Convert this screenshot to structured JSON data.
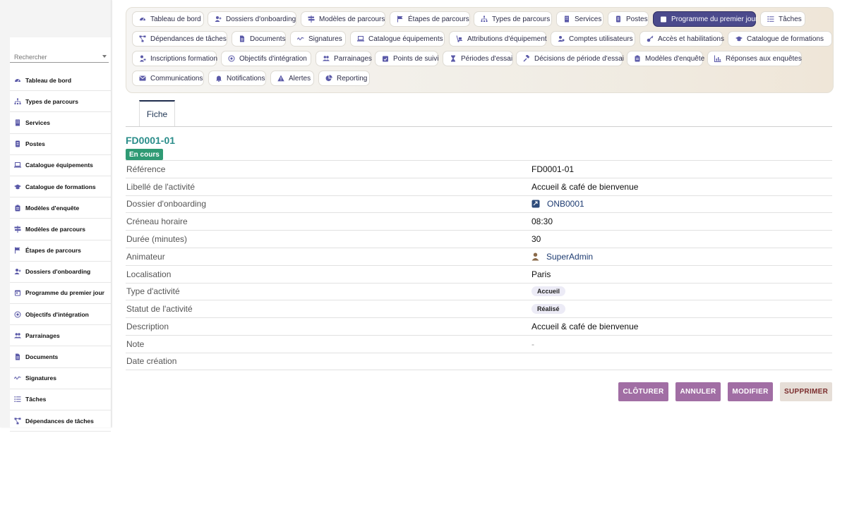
{
  "search": {
    "placeholder": "Rechercher"
  },
  "sidebar": {
    "items": [
      {
        "label": "Tableau de bord",
        "icon": "dashboard-icon"
      },
      {
        "label": "Types de parcours",
        "icon": "sitemap-icon"
      },
      {
        "label": "Services",
        "icon": "building-icon"
      },
      {
        "label": "Postes",
        "icon": "id-badge-icon"
      },
      {
        "label": "Catalogue équipements",
        "icon": "laptop-icon"
      },
      {
        "label": "Catalogue de formations",
        "icon": "graduation-cap-icon"
      },
      {
        "label": "Modèles d'enquête",
        "icon": "clipboard-icon"
      },
      {
        "label": "Modèles de parcours",
        "icon": "signpost-icon"
      },
      {
        "label": "Étapes de parcours",
        "icon": "flag-icon"
      },
      {
        "label": "Dossiers d'onboarding",
        "icon": "user-plus-icon"
      },
      {
        "label": "Programme du premier jour",
        "icon": "calendar-day-icon"
      },
      {
        "label": "Objectifs d'intégration",
        "icon": "target-icon"
      },
      {
        "label": "Parrainages",
        "icon": "users-icon"
      },
      {
        "label": "Documents",
        "icon": "file-icon"
      },
      {
        "label": "Signatures",
        "icon": "signature-icon"
      },
      {
        "label": "Tâches",
        "icon": "list-check-icon"
      },
      {
        "label": "Dépendances de tâches",
        "icon": "project-diagram-icon"
      }
    ]
  },
  "topnav": {
    "items": [
      {
        "label": "Tableau de bord",
        "icon": "dashboard-icon"
      },
      {
        "label": "Dossiers d'onboarding",
        "icon": "user-plus-icon"
      },
      {
        "label": "Modèles de parcours",
        "icon": "signpost-icon"
      },
      {
        "label": "Étapes de parcours",
        "icon": "flag-icon"
      },
      {
        "label": "Types de parcours",
        "icon": "sitemap-icon"
      },
      {
        "label": "Services",
        "icon": "building-icon"
      },
      {
        "label": "Postes",
        "icon": "id-badge-icon"
      },
      {
        "label": "Programme du premier jour",
        "icon": "calendar-day-icon",
        "active": true
      },
      {
        "label": "Tâches",
        "icon": "list-check-icon"
      },
      {
        "label": "Dépendances de tâches",
        "icon": "project-diagram-icon"
      },
      {
        "label": "Documents",
        "icon": "file-icon"
      },
      {
        "label": "Signatures",
        "icon": "signature-icon"
      },
      {
        "label": "Catalogue équipements",
        "icon": "laptop-icon"
      },
      {
        "label": "Attributions d'équipement",
        "icon": "dolly-icon"
      },
      {
        "label": "Comptes utilisateurs",
        "icon": "user-gear-icon"
      },
      {
        "label": "Accès et habilitations",
        "icon": "key-icon"
      },
      {
        "label": "Catalogue de formations",
        "icon": "graduation-cap-icon"
      },
      {
        "label": "Inscriptions formation",
        "icon": "user-tag-icon"
      },
      {
        "label": "Objectifs d'intégration",
        "icon": "target-icon"
      },
      {
        "label": "Parrainages",
        "icon": "users-icon"
      },
      {
        "label": "Points de suivi",
        "icon": "calendar-check-icon"
      },
      {
        "label": "Périodes d'essai",
        "icon": "hourglass-icon"
      },
      {
        "label": "Décisions de période d'essai",
        "icon": "gavel-icon"
      },
      {
        "label": "Modèles d'enquête",
        "icon": "clipboard-icon"
      },
      {
        "label": "Réponses aux enquêtes",
        "icon": "chart-icon"
      },
      {
        "label": "Communications",
        "icon": "envelope-icon"
      },
      {
        "label": "Notifications",
        "icon": "bell-icon"
      },
      {
        "label": "Alertes",
        "icon": "warning-icon"
      },
      {
        "label": "Reporting",
        "icon": "pie-chart-icon"
      }
    ]
  },
  "tabs": {
    "fiche": "Fiche"
  },
  "record": {
    "title": "FD0001-01",
    "status": "En cours",
    "fields": [
      {
        "label": "Référence",
        "value": "FD0001-01",
        "kind": "text"
      },
      {
        "label": "Libellé de l'activité",
        "value": "Accueil & café de bienvenue",
        "kind": "text"
      },
      {
        "label": "Dossier d'onboarding",
        "value": "ONB0001",
        "kind": "link",
        "icon": "folder-link-icon"
      },
      {
        "label": "Créneau horaire",
        "value": "08:30",
        "kind": "text"
      },
      {
        "label": "Durée (minutes)",
        "value": "30",
        "kind": "text"
      },
      {
        "label": "Animateur",
        "value": "SuperAdmin",
        "kind": "link",
        "icon": "user-icon"
      },
      {
        "label": "Localisation",
        "value": "Paris",
        "kind": "text"
      },
      {
        "label": "Type d'activité",
        "value": "Accueil",
        "kind": "pill"
      },
      {
        "label": "Statut de l'activité",
        "value": "Réalisé",
        "kind": "pill"
      },
      {
        "label": "Description",
        "value": "Accueil & café de bienvenue",
        "kind": "text"
      },
      {
        "label": "Note",
        "value": "-",
        "kind": "dash"
      },
      {
        "label": "Date création",
        "value": "",
        "kind": "text"
      }
    ]
  },
  "actions": {
    "close": "CLÔTURER",
    "cancel": "ANNULER",
    "edit": "MODIFIER",
    "delete": "SUPPRIMER"
  },
  "colors": {
    "accent": "#4b4a8c",
    "title": "#2a8d8a",
    "status_badge": "#2f9a74",
    "action_button": "#a16ea4",
    "delete_button": "#e6ded7",
    "icon": "#5b5aa8"
  }
}
